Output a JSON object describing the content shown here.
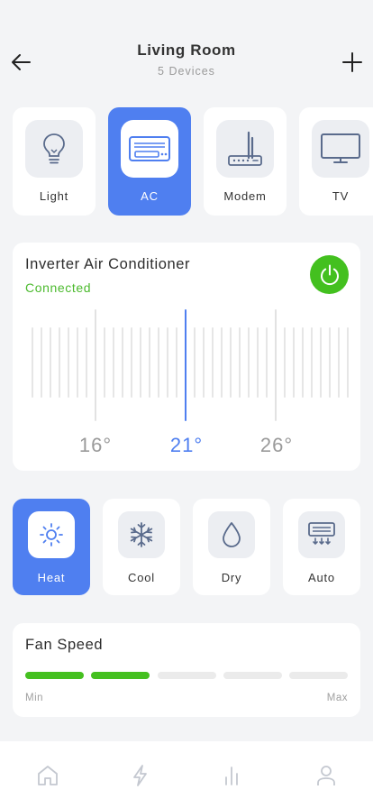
{
  "header": {
    "title": "Living Room",
    "subtitle": "5 Devices"
  },
  "devices": [
    {
      "label": "Light",
      "icon": "bulb-icon",
      "active": false
    },
    {
      "label": "AC",
      "icon": "air-conditioner-icon",
      "active": true
    },
    {
      "label": "Modem",
      "icon": "router-icon",
      "active": false
    },
    {
      "label": "TV",
      "icon": "tv-icon",
      "active": false
    }
  ],
  "ac": {
    "name": "Inverter Air Conditioner",
    "status": "Connected",
    "temperature": {
      "min_label": "16°",
      "current_label": "21°",
      "max_label": "26°",
      "current_value": 21
    }
  },
  "modes": [
    {
      "label": "Heat",
      "icon": "sun-icon",
      "active": true
    },
    {
      "label": "Cool",
      "icon": "snowflake-icon",
      "active": false
    },
    {
      "label": "Dry",
      "icon": "droplet-icon",
      "active": false
    },
    {
      "label": "Auto",
      "icon": "ac-auto-icon",
      "active": false
    }
  ],
  "fan": {
    "title": "Fan Speed",
    "min_label": "Min",
    "max_label": "Max",
    "level": 2,
    "levels_total": 5
  },
  "tabbar": {
    "items": [
      "home-icon",
      "bolt-icon",
      "stats-icon",
      "profile-icon"
    ]
  },
  "colors": {
    "accent_blue": "#4f7ff0",
    "connected_green": "#4cba2e",
    "power_green": "#43c01f",
    "fan_green": "#45c020"
  }
}
